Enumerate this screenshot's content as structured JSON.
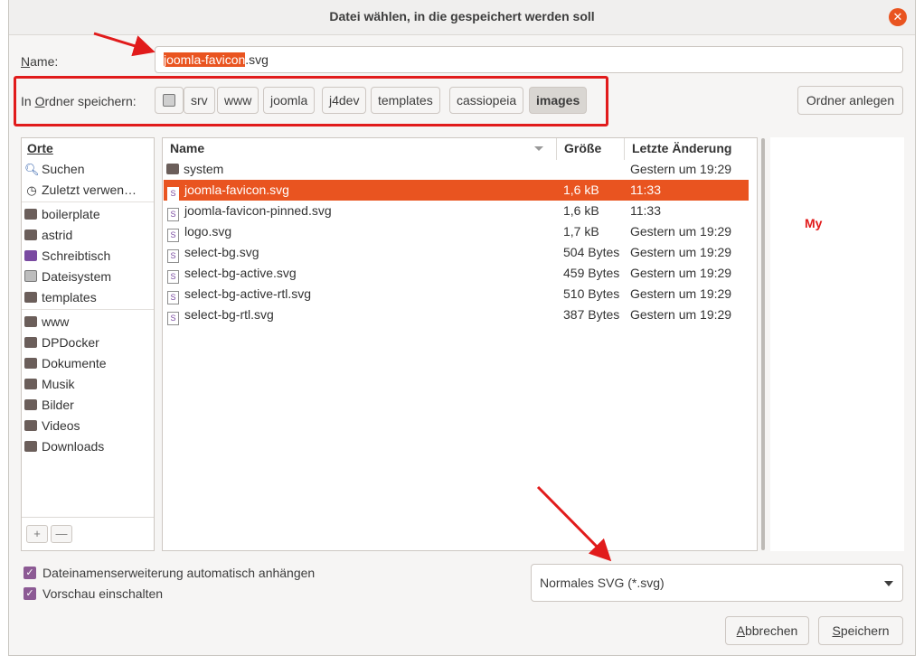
{
  "window": {
    "title": "Datei wählen, in die gespeichert werden soll",
    "close_glyph": "✕"
  },
  "name_field": {
    "label_underlined": "N",
    "label_rest": "ame:",
    "value_selected": "joomla-favicon",
    "value_rest": ".svg"
  },
  "path_bar": {
    "label_prefix": "In ",
    "label_underlined": "O",
    "label_rest": "rdner speichern:",
    "crumbs": [
      "srv",
      "www",
      "joomla",
      "j4dev",
      "templates",
      "cassiopeia",
      "images"
    ],
    "active_crumb": "images"
  },
  "create_folder_label": "Ordner anlegen",
  "sidebar": {
    "heading": "Orte",
    "items": [
      {
        "label": "Suchen",
        "icon": "search-icon"
      },
      {
        "label": "Zuletzt verwen…",
        "icon": "recent-icon"
      },
      {
        "label": "boilerplate",
        "icon": "folder-icon"
      },
      {
        "label": "astrid",
        "icon": "folder-icon"
      },
      {
        "label": "Schreibtisch",
        "icon": "desktop-icon"
      },
      {
        "label": "Dateisystem",
        "icon": "drive-icon"
      },
      {
        "label": "templates",
        "icon": "folder-icon"
      },
      {
        "label": "www",
        "icon": "folder-icon"
      },
      {
        "label": "DPDocker",
        "icon": "folder-icon"
      },
      {
        "label": "Dokumente",
        "icon": "folder-icon"
      },
      {
        "label": "Musik",
        "icon": "folder-icon"
      },
      {
        "label": "Bilder",
        "icon": "folder-icon"
      },
      {
        "label": "Videos",
        "icon": "folder-icon"
      },
      {
        "label": "Downloads",
        "icon": "folder-icon"
      }
    ],
    "add_glyph": "+",
    "remove_glyph": "—"
  },
  "file_list": {
    "columns": {
      "name": "Name",
      "size": "Größe",
      "modified": "Letzte Änderung"
    },
    "rows": [
      {
        "name": "system",
        "size": "",
        "modified": "Gestern um 19:29",
        "type": "folder"
      },
      {
        "name": "joomla-favicon.svg",
        "size": "1,6 kB",
        "modified": "11:33",
        "type": "svg",
        "selected": true
      },
      {
        "name": "joomla-favicon-pinned.svg",
        "size": "1,6 kB",
        "modified": "11:33",
        "type": "svg"
      },
      {
        "name": "logo.svg",
        "size": "1,7 kB",
        "modified": "Gestern um 19:29",
        "type": "svg"
      },
      {
        "name": "select-bg.svg",
        "size": "504 Bytes",
        "modified": "Gestern um 19:29",
        "type": "svg"
      },
      {
        "name": "select-bg-active.svg",
        "size": "459 Bytes",
        "modified": "Gestern um 19:29",
        "type": "svg"
      },
      {
        "name": "select-bg-active-rtl.svg",
        "size": "510 Bytes",
        "modified": "Gestern um 19:29",
        "type": "svg"
      },
      {
        "name": "select-bg-rtl.svg",
        "size": "387 Bytes",
        "modified": "Gestern um 19:29",
        "type": "svg"
      }
    ]
  },
  "preview": {
    "label": "My"
  },
  "options": {
    "auto_extension": "Dateinamenserweiterung automatisch anhängen",
    "show_preview": "Vorschau einschalten"
  },
  "filetype": {
    "selected": "Normales SVG (*.svg)"
  },
  "buttons": {
    "cancel_underlined": "A",
    "cancel_rest": "bbrechen",
    "save_underlined": "S",
    "save_rest": "peichern"
  },
  "colors": {
    "accent": "#e95420",
    "annotation_red": "#e11b1b",
    "checkbox": "#8c5a94"
  }
}
